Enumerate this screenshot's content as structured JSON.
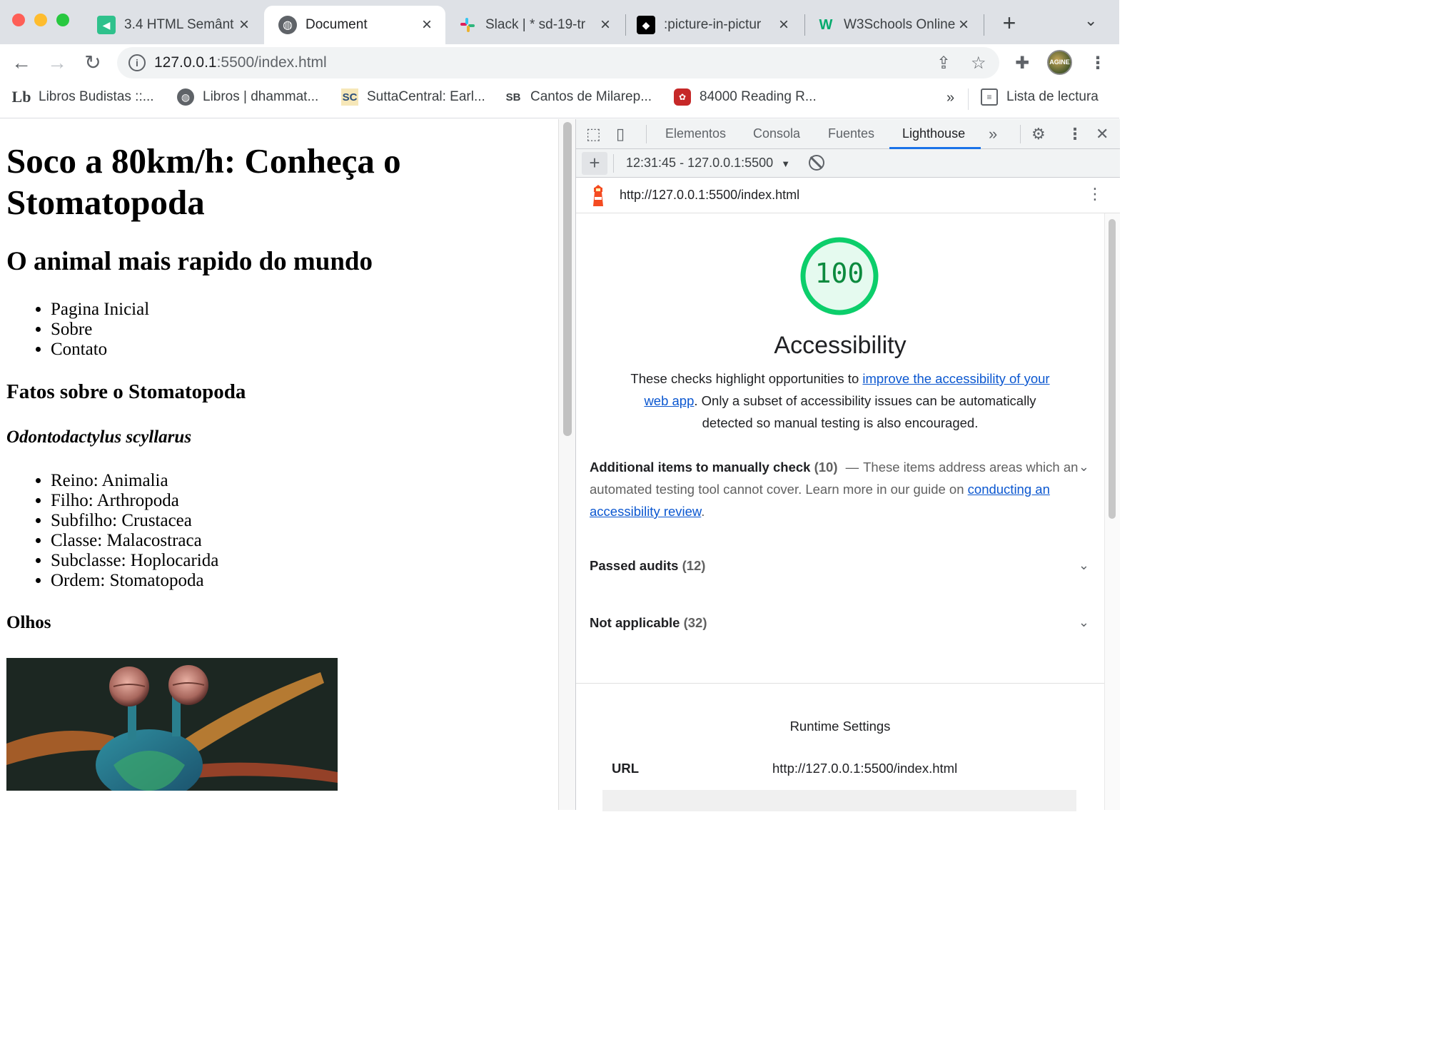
{
  "browser": {
    "tabs": [
      {
        "title": "3.4 HTML Semânt",
        "favicon": "trybe-icon",
        "active": false
      },
      {
        "title": "Document",
        "favicon": "globe-icon",
        "active": true
      },
      {
        "title": "Slack | * sd-19-tr",
        "favicon": "slack-icon",
        "active": false
      },
      {
        "title": ":picture-in-pictur",
        "favicon": "github-icon",
        "active": false
      },
      {
        "title": "W3Schools Online",
        "favicon": "w3schools-icon",
        "active": false
      }
    ],
    "new_tab_label": "+",
    "url_host": "127.0.0.1",
    "url_rest": ":5500/index.html",
    "bookmarks": [
      {
        "label": "Libros Budistas ::...",
        "icon": "lb-icon"
      },
      {
        "label": "Libros | dhammat...",
        "icon": "globe-icon"
      },
      {
        "label": "SuttaCentral: Earl...",
        "icon": "sc-icon",
        "badge": "SC"
      },
      {
        "label": "Cantos de Milarep...",
        "icon": "sb-icon",
        "badge": "SB"
      },
      {
        "label": "84000 Reading R...",
        "icon": "84000-icon"
      }
    ],
    "bookmarks_overflow": "»",
    "reading_list": "Lista de lectura",
    "avatar_text": "AGINE"
  },
  "page": {
    "h1": "Soco a 80km/h: Conheça o Stomatopoda",
    "h2": "O animal mais rapido do mundo",
    "nav": [
      "Pagina Inicial",
      "Sobre",
      "Contato"
    ],
    "facts_heading": "Fatos sobre o Stomatopoda",
    "species": "Odontodactylus scyllarus",
    "taxonomy": [
      "Reino: Animalia",
      "Filho: Arthropoda",
      "Subfilho: Crustacea",
      "Classe: Malacostraca",
      "Subclasse: Hoplocarida",
      "Ordem: Stomatopoda"
    ],
    "eyes_heading": "Olhos"
  },
  "devtools": {
    "tabs": [
      "Elementos",
      "Consola",
      "Fuentes",
      "Lighthouse"
    ],
    "active_tab": "Lighthouse",
    "report_select": "12:31:45 - 127.0.0.1:5500",
    "report_url": "http://127.0.0.1:5500/index.html",
    "score": "100",
    "category_title": "Accessibility",
    "desc_before": "These checks highlight opportunities to ",
    "desc_link": "improve the accessibility of your web app",
    "desc_after": ". Only a subset of accessibility issues can be automatically detected so manual testing is also encouraged.",
    "manual": {
      "title": "Additional items to manually check",
      "count": "(10)",
      "dash": "—",
      "text": "These items address areas which an automated testing tool cannot cover. Learn more in our guide on ",
      "link": "conducting an accessibility review",
      "end": "."
    },
    "passed": {
      "title": "Passed audits",
      "count": "(12)"
    },
    "not_applicable": {
      "title": "Not applicable",
      "count": "(32)"
    },
    "runtime_title": "Runtime Settings",
    "runtime_url_label": "URL",
    "runtime_url_value": "http://127.0.0.1:5500/index.html"
  },
  "colors": {
    "score_good": "#0cce6b",
    "link": "#0b57d0",
    "tab_accent": "#1a73e8"
  }
}
